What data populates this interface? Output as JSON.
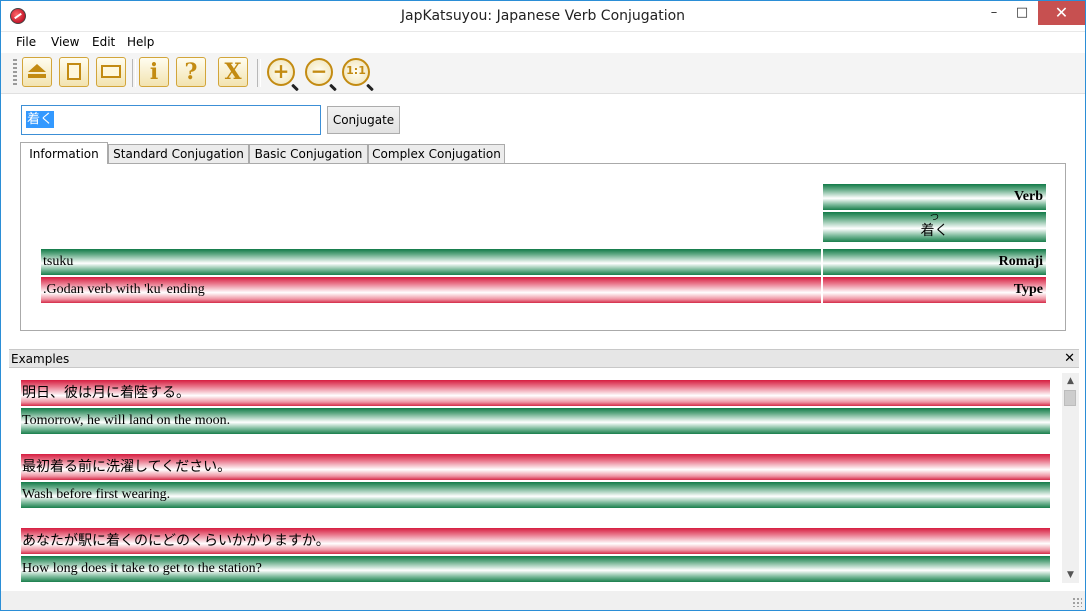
{
  "window": {
    "title": "JapKatsuyou: Japanese Verb Conjugation",
    "minimize": "–",
    "maximize": "□",
    "close": "✕"
  },
  "menu": [
    "File",
    "View",
    "Edit",
    "Help"
  ],
  "toolbar": {
    "buttons": [
      {
        "icon": "eject-icon"
      },
      {
        "icon": "document-icon"
      },
      {
        "icon": "window-icon"
      },
      {
        "icon": "info-icon",
        "glyph": "i"
      },
      {
        "icon": "help-icon",
        "glyph": "?"
      },
      {
        "icon": "exit-icon",
        "glyph": "X"
      },
      {
        "icon": "zoom-in-icon",
        "glyph": "+"
      },
      {
        "icon": "zoom-out-icon",
        "glyph": "−"
      },
      {
        "icon": "zoom-reset-icon",
        "glyph": "1:1"
      }
    ],
    "accent": "#c38b12"
  },
  "search": {
    "value": "着く",
    "button_label": "Conjugate"
  },
  "tabs": [
    "Information",
    "Standard Conjugation",
    "Basic Conjugation",
    "Complex Conjugation"
  ],
  "info": {
    "verb_label": "Verb",
    "verb_reading": "つ",
    "verb_value": "着く",
    "romaji_label": "Romaji",
    "romaji_value": "tsuku",
    "type_label": "Type",
    "type_value": ".Godan verb with 'ku' ending"
  },
  "examples": {
    "header": "Examples",
    "close": "✕",
    "items": [
      {
        "jp": "明日、彼は月に着陸する。",
        "en": "Tomorrow, he will land on the moon."
      },
      {
        "jp": "最初着る前に洗濯してください。",
        "en": "Wash before first wearing."
      },
      {
        "jp": "あなたが駅に着くのにどのくらいかかりますか。",
        "en": "How long does it take to get to the station?"
      }
    ]
  },
  "colors": {
    "green": "#127a48",
    "red": "#d61d40",
    "window_border": "#2b8ed6",
    "close_button": "#c75050"
  }
}
